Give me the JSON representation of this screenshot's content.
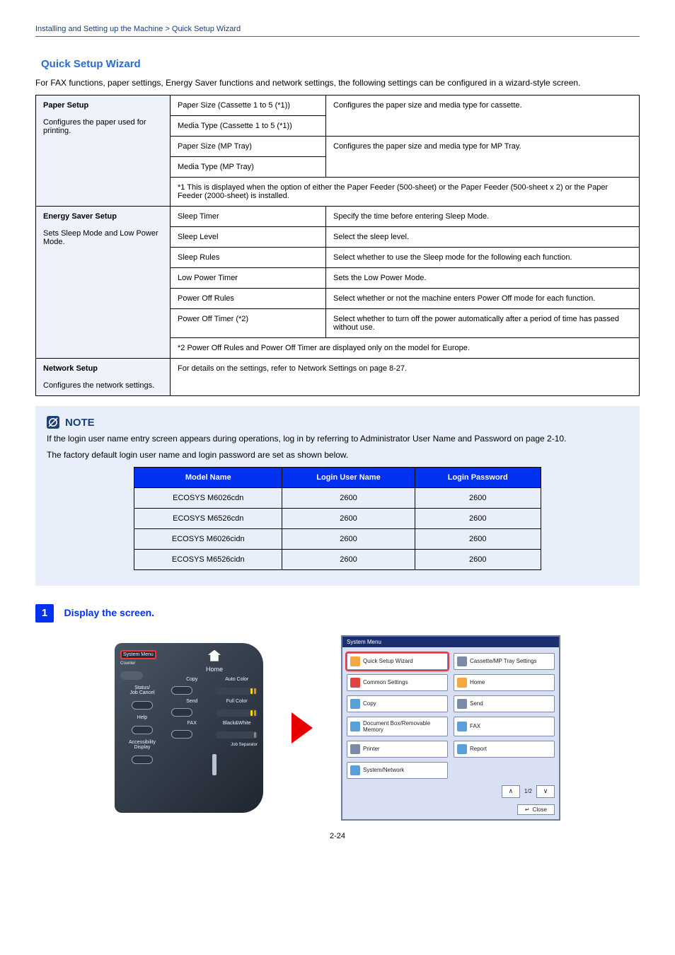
{
  "breadcrumb_left": "Installing and Setting up the Machine > Quick Setup Wizard",
  "breadcrumb_right": "",
  "section": {
    "number": "",
    "title": "Quick Setup Wizard"
  },
  "intro": "For FAX functions, paper settings, Energy Saver functions and network settings, the following settings can be configured in a wizard-style screen.",
  "table": {
    "headers": {
      "c1": "",
      "c2": "",
      "c3": ""
    },
    "rows": [
      {
        "group": "Paper Setup",
        "group_desc": "Configures the paper used for printing.",
        "setting": "Paper Size (Cassette 1 to 5 (*1))",
        "detail": "Configures the paper size and media type for cassette.",
        "sub": [
          {
            "setting": "Media Type (Cassette 1 to 5 (*1))",
            "detail_ref": "(uses row above)"
          },
          {
            "setting": "Paper Size (MP Tray)",
            "detail_head": "Configures the paper size and media type for MP Tray."
          },
          {
            "setting": "Media Type (MP Tray)",
            "detail_ref": "(uses row above)"
          }
        ],
        "note1": "*1  This is displayed when the option of either the Paper Feeder (500-sheet) or the Paper Feeder (500-sheet x 2) or the Paper Feeder (2000-sheet) is installed."
      },
      {
        "group": "Energy Saver Setup",
        "group_desc": "Sets Sleep Mode and Low Power Mode.",
        "setting": "Sleep Timer",
        "detail": "Specify the time before entering Sleep Mode."
      },
      {
        "setting": "Sleep Level",
        "detail": "Select the sleep level."
      },
      {
        "setting": "Sleep Rules",
        "detail": "Select whether to use the Sleep mode for the following each function."
      },
      {
        "setting": "Low Power Timer",
        "detail": "Sets the Low Power Mode."
      },
      {
        "setting": "Power Off Rules",
        "detail": "Select whether or not the machine enters Power Off mode for each function.",
        "note2": "*2  Power Off Rules and Power Off Timer are displayed only on the model for Europe."
      },
      {
        "setting": "Power Off Timer (*2)",
        "detail": "Select whether to turn off the power automatically after a period of time has passed without use."
      },
      {
        "group": "Network Setup",
        "group_desc": "Configures the network settings.",
        "items_note": "For details on the settings, refer to Network Settings on page 8-27."
      }
    ]
  },
  "note": {
    "heading": "NOTE",
    "line1": "If the login user name entry screen appears during operations, log in by referring to Administrator User Name and Password on page 2-10.",
    "line2": "The factory default login user name and login password are set as shown below.",
    "table": {
      "headers": [
        "Model Name",
        "Login User Name",
        "Login Password"
      ],
      "rows": [
        [
          "ECOSYS M6026cdn",
          "2600",
          "2600"
        ],
        [
          "ECOSYS M6526cdn",
          "2600",
          "2600"
        ],
        [
          "ECOSYS M6026cidn",
          "2600",
          "2600"
        ],
        [
          "ECOSYS M6526cidn",
          "2600",
          "2600"
        ]
      ]
    }
  },
  "step": {
    "num": "1",
    "title": "Display the screen."
  },
  "panel": {
    "sysmenu": "System Menu",
    "counter": "Counter",
    "status": "Status/\nJob Cancel",
    "help": "Help",
    "acc": "Accessibility\nDisplay",
    "home_lbl": "Home",
    "copy": "Copy",
    "autocolor": "Auto Color",
    "send": "Send",
    "fullcolor": "Full Color",
    "fax": "FAX",
    "bw": "Black&White",
    "jobsep": "Job Separator"
  },
  "touch": {
    "title": "System Menu",
    "btns": [
      {
        "label": "Quick Setup Wizard",
        "color": "#f5a742",
        "sel": true
      },
      {
        "label": "Cassette/MP Tray Settings",
        "color": "#7a8aa8"
      },
      {
        "label": "Common Settings",
        "color": "#d44"
      },
      {
        "label": "Home",
        "color": "#f5a742"
      },
      {
        "label": "Copy",
        "color": "#5aa0d8"
      },
      {
        "label": "Send",
        "color": "#7a8aa8"
      },
      {
        "label": "Document Box/Removable Memory",
        "color": "#5aa0d8"
      },
      {
        "label": "FAX",
        "color": "#5aa0d8"
      },
      {
        "label": "Printer",
        "color": "#7a8aa8"
      },
      {
        "label": "Report",
        "color": "#5aa0d8"
      },
      {
        "label": "System/Network",
        "color": "#5aa0d8"
      }
    ],
    "page": "1/2",
    "close": "Close"
  },
  "pagenum": "2-24"
}
